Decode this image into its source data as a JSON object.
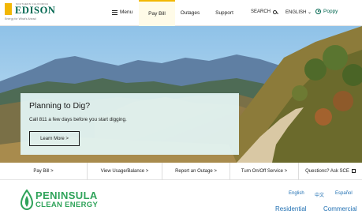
{
  "brand": {
    "pre_text": "SOUTHERN CALIFORNIA",
    "name": "EDISON",
    "tagline": "Energy for What's Ahead"
  },
  "header": {
    "menu_label": "Menu",
    "tabs": [
      {
        "label": "Pay Bill",
        "active": true
      },
      {
        "label": "Outages",
        "active": false
      },
      {
        "label": "Support",
        "active": false
      }
    ],
    "search_label": "SEARCH",
    "language_label": "ENGLISH",
    "user_name": "Poppy"
  },
  "hero": {
    "title": "Planning to Dig?",
    "text": "Call 811 a few days before you start digging.",
    "button_label": "Learn More >"
  },
  "quick_links": [
    {
      "label": "Pay Bill >"
    },
    {
      "label": "View Usage/Balance >"
    },
    {
      "label": "Report an Outage >"
    },
    {
      "label": "Turn On/Off Service >"
    },
    {
      "label": "Questions? Ask SCE"
    }
  ],
  "partner": {
    "name_line1": "PENINSULA",
    "name_line2": "CLEAN ENERGY",
    "languages": [
      "English",
      "中文",
      "Español"
    ],
    "segments": [
      "Residential",
      "Commercial"
    ]
  },
  "colors": {
    "brand_green": "#00664f",
    "brand_yellow": "#f2b705",
    "pce_green": "#2fa35a",
    "link_blue": "#1f6fb2"
  }
}
